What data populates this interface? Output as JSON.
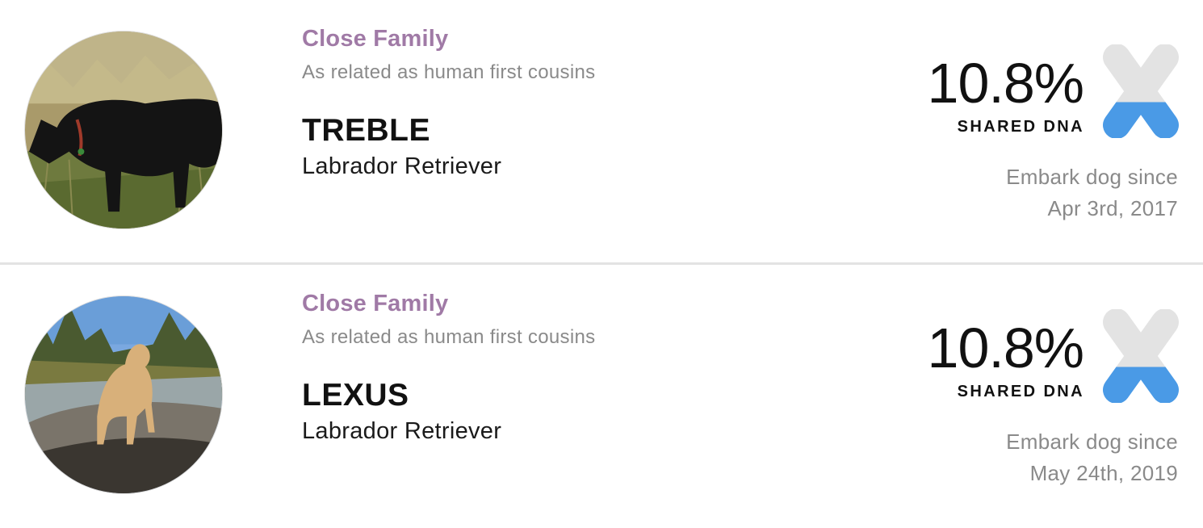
{
  "matches": [
    {
      "relationship": "Close Family",
      "relationship_description": "As related as human first cousins",
      "name": "TREBLE",
      "breed": "Labrador Retriever",
      "shared_dna_percent": "10.8%",
      "shared_dna_label": "SHARED DNA",
      "since_label": "Embark dog since",
      "since_date": "Apr 3rd, 2017"
    },
    {
      "relationship": "Close Family",
      "relationship_description": "As related as human first cousins",
      "name": "LEXUS",
      "breed": "Labrador Retriever",
      "shared_dna_percent": "10.8%",
      "shared_dna_label": "SHARED DNA",
      "since_label": "Embark dog since",
      "since_date": "May 24th, 2019"
    }
  ],
  "colors": {
    "relationship": "#a07aa6",
    "chromosome_fill": "#4a9ae6",
    "chromosome_empty": "#e3e3e3",
    "divider": "#e3e3e3"
  },
  "icons": {
    "chromosome": "chromosome-icon"
  }
}
